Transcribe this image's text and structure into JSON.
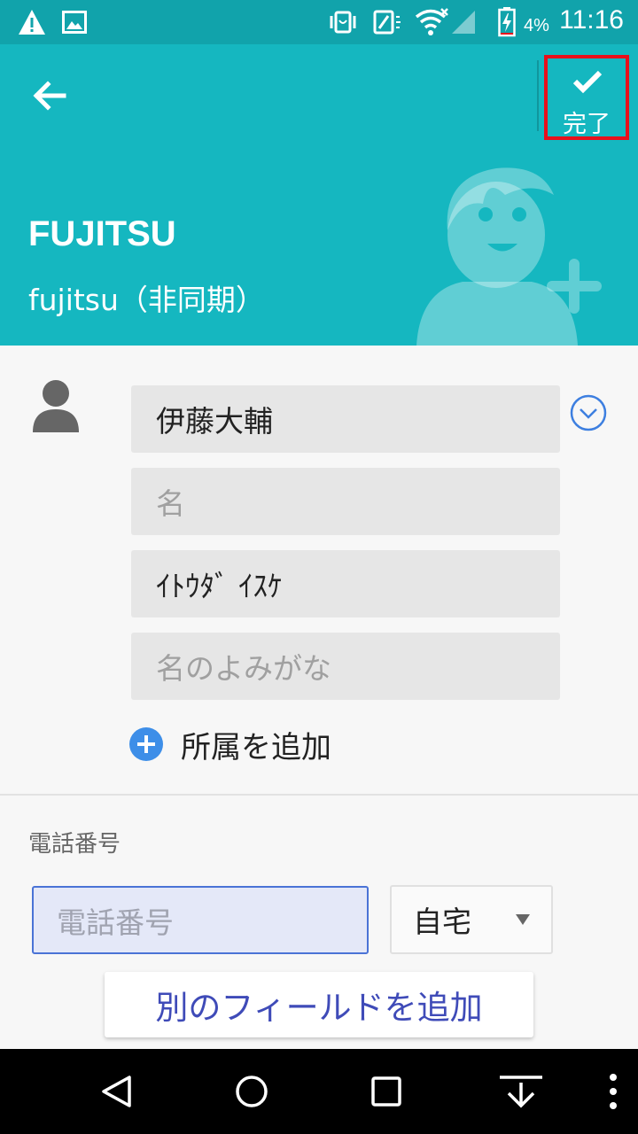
{
  "status_bar": {
    "time": "11:16",
    "battery_percent": "4%",
    "icons": [
      "warning-icon",
      "image-icon",
      "vibrate-icon",
      "nfc-icon",
      "wifi-icon",
      "signal-icon",
      "battery-charging-icon"
    ]
  },
  "header": {
    "done_label": "完了",
    "account_name": "FUJITSU",
    "account_type": "fujitsu（非同期）",
    "colors": {
      "background": "#15b7c0",
      "highlight_border": "#e8101b"
    }
  },
  "name_section": {
    "last_name_value": "伊藤大輔",
    "first_name_placeholder": "名",
    "last_name_reading_value": "ｲﾄｳﾀﾞ ｲｽｹ",
    "first_name_reading_placeholder": "名のよみがな",
    "add_organization_label": "所属を追加"
  },
  "phone_section": {
    "label": "電話番号",
    "input_placeholder": "電話番号",
    "type_value": "自宅"
  },
  "add_field_label": "別のフィールドを追加",
  "nav_bar": {
    "buttons": [
      "back-nav",
      "home-nav",
      "recents-nav",
      "download-nav",
      "menu-nav"
    ]
  }
}
